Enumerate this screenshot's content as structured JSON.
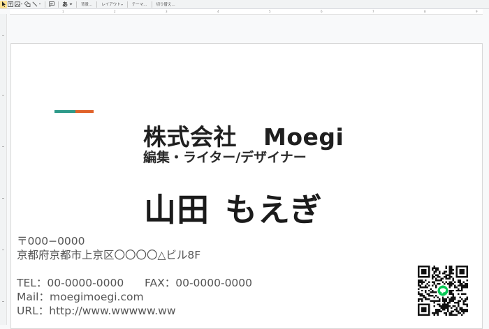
{
  "toolbar": {
    "aa_label": "あ",
    "background_label": "背景...",
    "layout_label": "レイアウト",
    "theme_label": "テーマ...",
    "transition_label": "切り替え..."
  },
  "ruler": {
    "numbers": [
      "1",
      "2",
      "3",
      "4",
      "5",
      "6",
      "7",
      "8",
      "9"
    ]
  },
  "card": {
    "accent_colors": [
      "#2e9a8a",
      "#e0622a"
    ],
    "company": "株式会社",
    "company_en": "Moegi",
    "role": "編集・ライター/デザイナー",
    "family_name": "山田",
    "given_name": "もえぎ",
    "postal": "〒000−0000",
    "address": "京都府京都市上京区〇〇〇〇△ビル8F",
    "tel": "TEL：00-0000-0000",
    "fax": "FAX：00-0000-0000",
    "mail": "Mail：moegimoegi.com",
    "url": "URL：http://www.wwwww.ww",
    "qr_badge_color": "#06c755"
  }
}
